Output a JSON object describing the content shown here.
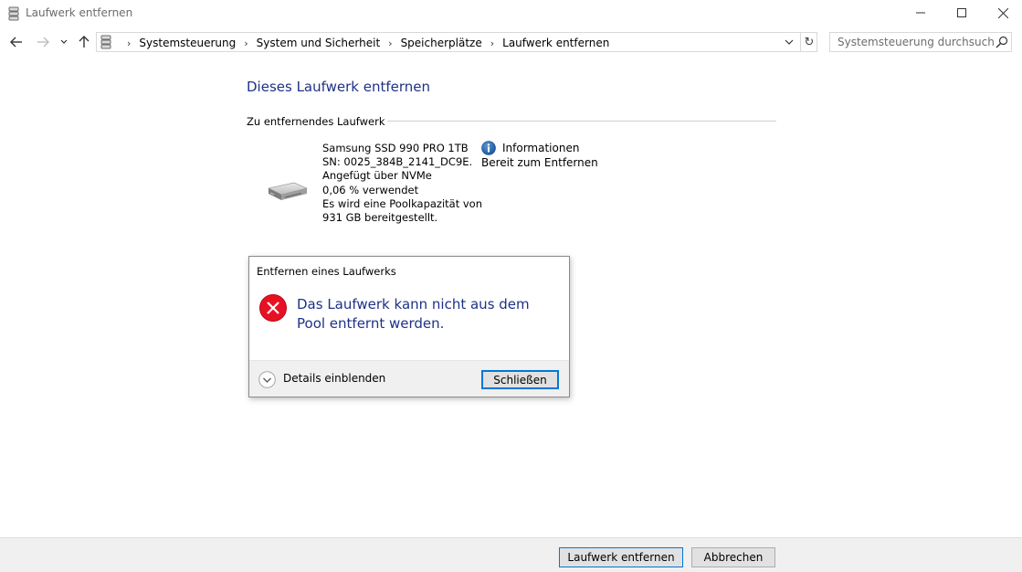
{
  "window": {
    "title": "Laufwerk entfernen",
    "icons": {
      "app": "storage-spaces-icon",
      "minimize": "minimize-icon",
      "maximize": "maximize-icon",
      "close": "close-icon"
    }
  },
  "nav": {
    "breadcrumbs": [
      "Systemsteuerung",
      "System und Sicherheit",
      "Speicherplätze",
      "Laufwerk entfernen"
    ],
    "search_placeholder": "Systemsteuerung durchsuchen",
    "refresh_glyph": "↻"
  },
  "main": {
    "heading": "Dieses Laufwerk entfernen",
    "group_label": "Zu entfernendes Laufwerk",
    "drive": {
      "icon": "hard-drive-icon",
      "lines": [
        "Samsung SSD 990 PRO 1TB",
        "SN: 0025_384B_2141_DC9E.",
        "Angefügt über NVMe",
        "0,06 % verwendet",
        "Es wird eine Poolkapazität von",
        "931 GB bereitgestellt."
      ]
    },
    "info": {
      "icon": "info-icon",
      "title": "Informationen",
      "status": "Bereit zum Entfernen"
    }
  },
  "dialog": {
    "title": "Entfernen eines Laufwerks",
    "icon": "error-icon",
    "message": "Das Laufwerk kann nicht aus dem Pool entfernt werden.",
    "details_label": "Details einblenden",
    "close_label": "Schließen"
  },
  "footer": {
    "remove_label": "Laufwerk entfernen",
    "cancel_label": "Abbrechen"
  },
  "colors": {
    "heading": "#1e3287",
    "accent": "#0078d7",
    "error": "#e81123"
  }
}
